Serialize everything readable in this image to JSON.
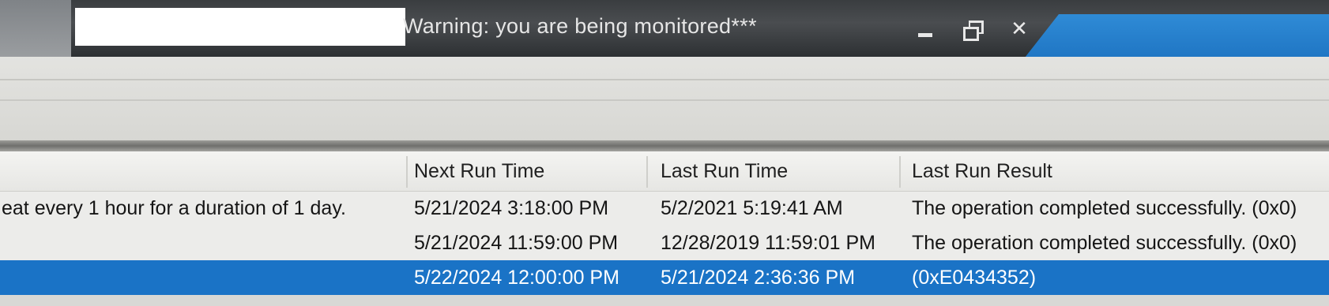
{
  "window": {
    "title": "Warning: you are being monitored***",
    "controls": {
      "minimize_icon": "minimize-icon",
      "restore_icon": "restore-icon",
      "close_glyph": "✕"
    },
    "accent_color": "#1a73c6"
  },
  "task_list": {
    "columns": [
      "Next Run Time",
      "Last Run Time",
      "Last Run Result"
    ],
    "rows": [
      {
        "trigger": "eat every 1 hour for a duration of 1 day.",
        "next_run": "5/21/2024 3:18:00 PM",
        "last_run": "5/2/2021 5:19:41 AM",
        "result": "The operation completed successfully. (0x0)",
        "selected": false
      },
      {
        "trigger": "",
        "next_run": "5/21/2024 11:59:00 PM",
        "last_run": "12/28/2019 11:59:01 PM",
        "result": "The operation completed successfully. (0x0)",
        "selected": false
      },
      {
        "trigger": "",
        "next_run": "5/22/2024 12:00:00 PM",
        "last_run": "5/21/2024 2:36:36 PM",
        "result": "(0xE0434352)",
        "selected": true
      }
    ]
  }
}
